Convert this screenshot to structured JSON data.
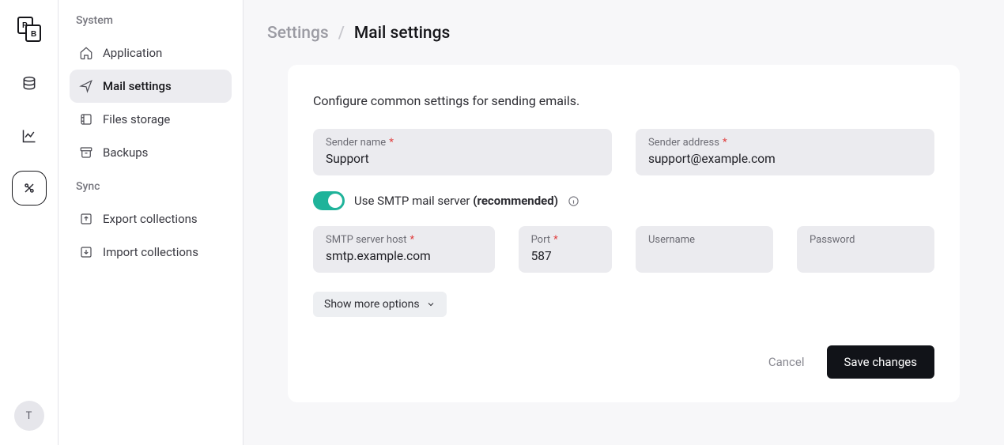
{
  "rail": {
    "avatar_initial": "T"
  },
  "sidebar": {
    "groups": [
      {
        "label": "System",
        "items": [
          {
            "label": "Application"
          },
          {
            "label": "Mail settings"
          },
          {
            "label": "Files storage"
          },
          {
            "label": "Backups"
          }
        ]
      },
      {
        "label": "Sync",
        "items": [
          {
            "label": "Export collections"
          },
          {
            "label": "Import collections"
          }
        ]
      }
    ]
  },
  "breadcrumb": {
    "root": "Settings",
    "current": "Mail settings"
  },
  "panel": {
    "description": "Configure common settings for sending emails.",
    "sender_name_label": "Sender name",
    "sender_name_value": "Support",
    "sender_address_label": "Sender address",
    "sender_address_value": "support@example.com",
    "smtp_toggle_label_prefix": "Use SMTP mail server ",
    "smtp_toggle_label_strong": "(recommended)",
    "smtp_host_label": "SMTP server host",
    "smtp_host_value": "smtp.example.com",
    "port_label": "Port",
    "port_value": "587",
    "username_label": "Username",
    "username_value": "",
    "password_label": "Password",
    "password_value": "",
    "show_more_label": "Show more options",
    "cancel_label": "Cancel",
    "save_label": "Save changes"
  }
}
